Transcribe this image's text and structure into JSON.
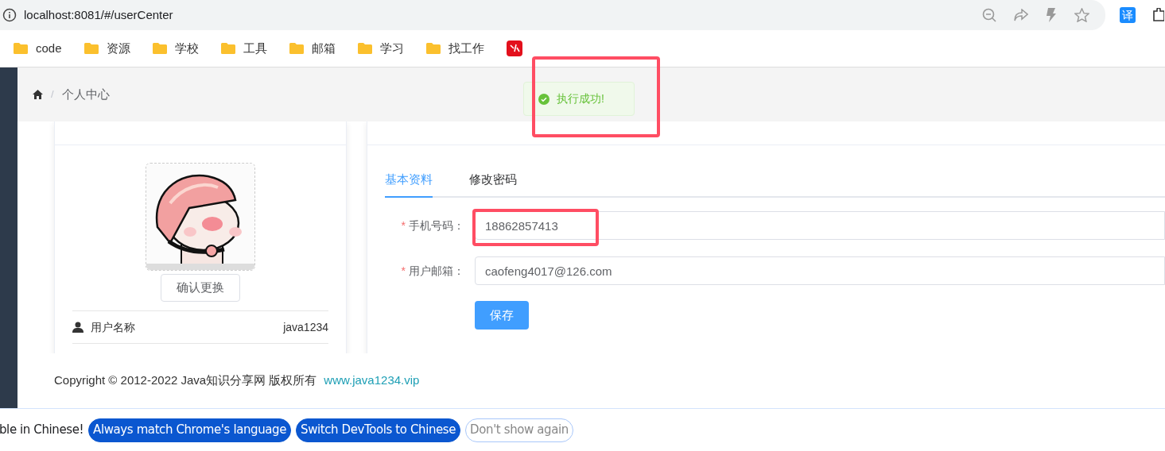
{
  "browser": {
    "url": "localhost:8081/#/userCenter",
    "translate_label": "译",
    "bookmarks": [
      {
        "kind": "folder",
        "label": "code"
      },
      {
        "kind": "folder",
        "label": "资源"
      },
      {
        "kind": "folder",
        "label": "学校"
      },
      {
        "kind": "folder",
        "label": "工具"
      },
      {
        "kind": "folder",
        "label": "邮箱"
      },
      {
        "kind": "folder",
        "label": "学习"
      },
      {
        "kind": "folder",
        "label": "找工作"
      },
      {
        "kind": "site"
      }
    ]
  },
  "breadcrumb": [
    "个人中心"
  ],
  "breadcrumb_separator": "/",
  "toast": {
    "kind": "success",
    "message": "执行成功!"
  },
  "profile": {
    "change_button": "确认更换",
    "rows": [
      {
        "label": "用户名称",
        "value": "java1234"
      }
    ]
  },
  "form": {
    "tabs": [
      {
        "label": "基本资料",
        "selected": true
      },
      {
        "label": "修改密码",
        "selected": false
      }
    ],
    "fields": [
      {
        "label": "手机号码：",
        "required": true,
        "value": "18862857413"
      },
      {
        "label": "用户邮箱：",
        "required": true,
        "value": "caofeng4017@126.com"
      }
    ],
    "save_button": "保存",
    "required_mark": "*"
  },
  "footer": {
    "text": "Copyright © 2012-2022 Java知识分享网 版权所有",
    "link": "www.java1234.vip"
  },
  "devtools_bar": {
    "message": "ble in Chinese!",
    "buttons": [
      {
        "kind": "primary",
        "label": "Always match Chrome's language"
      },
      {
        "kind": "primary",
        "label": "Switch DevTools to Chinese"
      },
      {
        "kind": "outline",
        "label": "Don't show again"
      }
    ]
  }
}
